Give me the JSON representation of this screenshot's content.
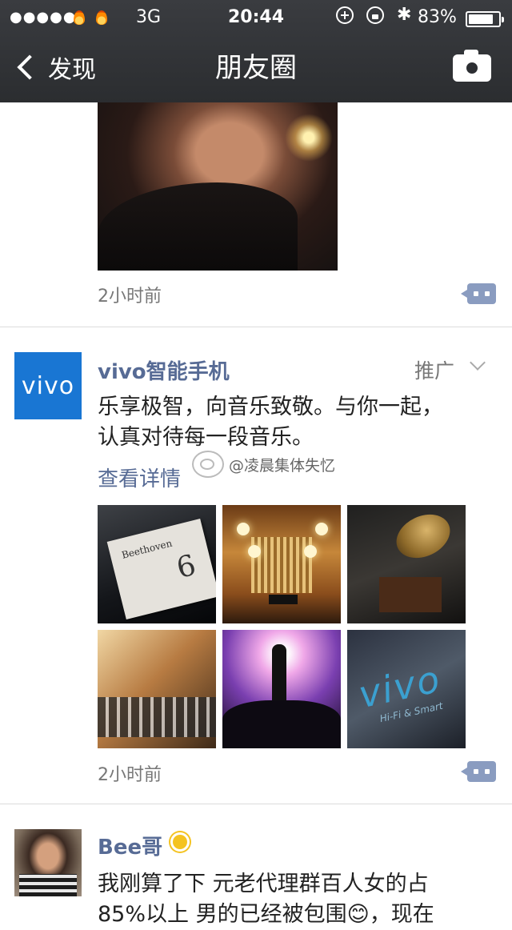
{
  "status_bar": {
    "signal": "●●●●●",
    "network": "3G",
    "time": "20:44",
    "battery": "83%",
    "battery_level": 0.83
  },
  "nav": {
    "back_label": "发现",
    "title": "朋友圈"
  },
  "feed": [
    {
      "time": "2小时前"
    },
    {
      "author": "vivo智能手机",
      "avatar_text": "vivo",
      "promo_label": "推广",
      "text_line1": "乐享极智，向音乐致敬。与你一起，",
      "text_line2": "认真对待每一段音乐。",
      "link": "查看详情",
      "watermark": "@凌晨集体失忆",
      "grid": {
        "card_text": "Beethoven",
        "card_number": "6",
        "logo_text": "vivo",
        "logo_sub": "Hi-Fi & Smart"
      },
      "time": "2小时前"
    },
    {
      "author": "Bee哥",
      "text_line1": "我刚算了下 元老代理群百人女的占",
      "text_line2": "85%以上 男的已经被包围😊，现在"
    }
  ],
  "colors": {
    "accent": "#576b95",
    "vivo_blue": "#1976d3",
    "nav_bg": "#2b2d30"
  }
}
